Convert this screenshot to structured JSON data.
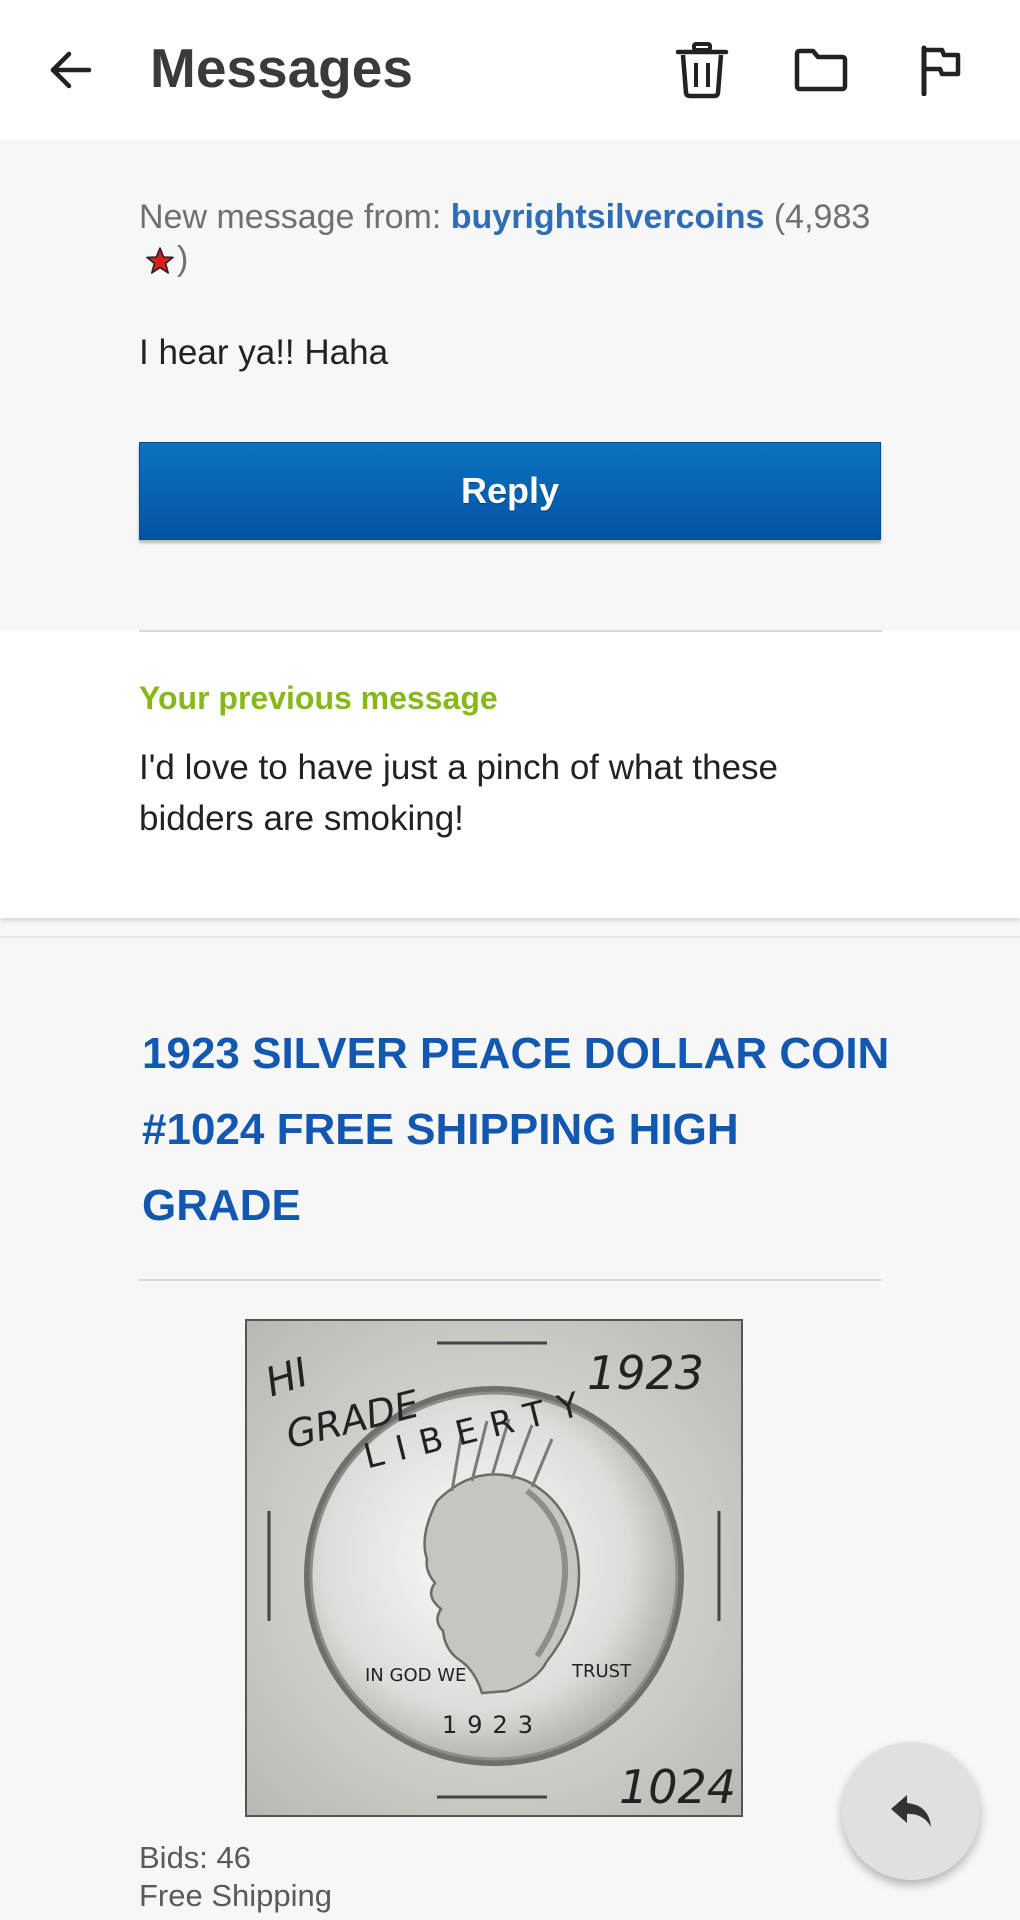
{
  "appbar": {
    "title": "Messages",
    "icons": [
      "back-arrow-icon",
      "trash-icon",
      "folder-icon",
      "flag-icon"
    ]
  },
  "message": {
    "from_prefix": "New message from: ",
    "sender": "buyrightsilvercoins",
    "feedback_open": "(4,983",
    "feedback_close": ")",
    "star_icon": "red-star-icon",
    "body": "I hear ya!! Haha",
    "reply_label": "Reply"
  },
  "previous": {
    "label": "Your previous message",
    "text": "I'd love to have just a pinch of what these bidders are smoking!"
  },
  "item": {
    "title": "1923 SILVER PEACE DOLLAR COIN #1024 FREE SHIPPING HIGH GRADE",
    "image_annotations": {
      "grade_top": "HI",
      "grade_bottom": "GRADE",
      "year": "1923",
      "lot": "1024",
      "coin_text_top": "LIBERTY",
      "coin_motto": "IN GOD WE",
      "coin_trust": "TRUST",
      "coin_date": "1923"
    },
    "bids": "Bids: 46",
    "shipping": "Free Shipping"
  },
  "colors": {
    "accent_blue": "#1257b0",
    "sender_blue": "#2f6db5",
    "prev_label_green": "#86b817",
    "reply_button": "#0552a3"
  },
  "fab": {
    "icon": "reply-icon"
  }
}
